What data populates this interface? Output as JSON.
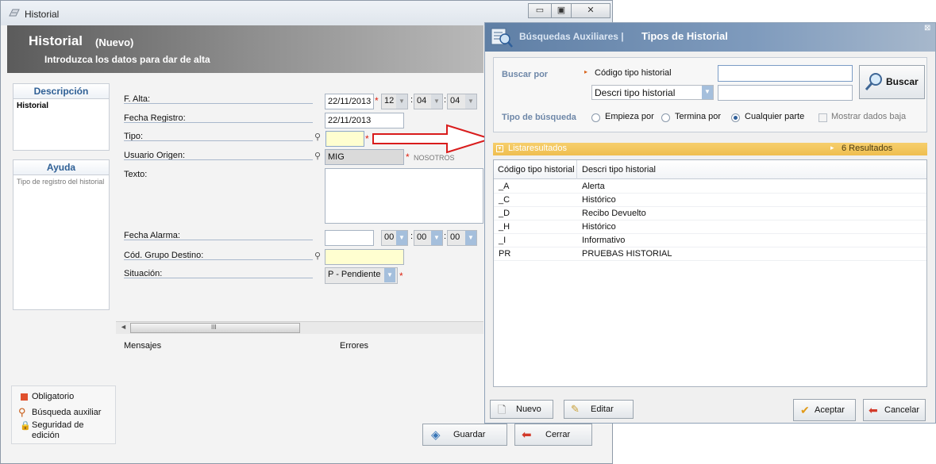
{
  "window": {
    "title": "Historial",
    "caption_buttons": [
      "▭",
      "▣",
      "✕"
    ]
  },
  "header": {
    "title": "Historial",
    "mode": "(Nuevo)",
    "subtitle": "Introduzca los datos para dar de alta"
  },
  "left_panels": {
    "descripcion": {
      "title": "Descripción",
      "text": "Historial"
    },
    "ayuda": {
      "title": "Ayuda",
      "text": "Tipo de registro del historial"
    }
  },
  "form": {
    "f_alta": {
      "label": "F. Alta:",
      "date": "22/11/2013",
      "hour": "12",
      "minute": "04",
      "second": "04"
    },
    "fecha_registro": {
      "label": "Fecha Registro:",
      "value": "22/11/2013"
    },
    "tipo": {
      "label": "Tipo:",
      "value": ""
    },
    "usuario_origen": {
      "label": "Usuario Origen:",
      "value": "MIG",
      "extra": "NOSOTROS"
    },
    "texto": {
      "label": "Texto:",
      "value": ""
    },
    "fecha_alarma": {
      "label": "Fecha Alarma:",
      "date": "",
      "hour": "00",
      "minute": "00",
      "second": "00"
    },
    "cod_grupo_destino": {
      "label": "Cód. Grupo Destino:",
      "value": ""
    },
    "situacion": {
      "label": "Situación:",
      "value": "P - Pendiente"
    }
  },
  "messages": {
    "mensajes": "Mensajes",
    "errores": "Errores",
    "scroll_grip": "III"
  },
  "legend": {
    "obligatorio": "Obligatorio",
    "busqueda": "Búsqueda auxiliar",
    "seguridad": "Seguridad de edición"
  },
  "buttons": {
    "guardar": "Guardar",
    "cerrar": "Cerrar"
  },
  "dialog": {
    "title1": "Búsquedas Auxiliares |",
    "title2": "Tipos de Historial",
    "buscar_por": "Buscar por",
    "codigo_label": "Código tipo historial",
    "descri_select": "Descri tipo historial",
    "buscar_button": "Buscar",
    "tipo_busqueda": "Tipo de búsqueda",
    "options": [
      "Empieza por",
      "Termina por",
      "Cualquier parte"
    ],
    "selected_option": "Cualquier parte",
    "mostrar_baja": "Mostrar dados baja",
    "results_bar": "Listaresultados",
    "results_count": "6 Resultados",
    "columns": [
      "Código tipo historial",
      "Descri tipo historial"
    ],
    "rows": [
      {
        "codigo": "_A",
        "descri": "Alerta"
      },
      {
        "codigo": "_C",
        "descri": "Histórico"
      },
      {
        "codigo": "_D",
        "descri": "Recibo Devuelto"
      },
      {
        "codigo": "_H",
        "descri": "Histórico"
      },
      {
        "codigo": "_I",
        "descri": "Informativo"
      },
      {
        "codigo": "PR",
        "descri": "PRUEBAS HISTORIAL"
      }
    ],
    "nuevo": "Nuevo",
    "editar": "Editar",
    "aceptar": "Aceptar",
    "cancelar": "Cancelar"
  },
  "colors": {
    "accent": "#2e5f95",
    "required": "#d21111",
    "yellow_field": "#fffed0",
    "results_bar": "#f4c75f",
    "arrow": "#d91c1c"
  }
}
